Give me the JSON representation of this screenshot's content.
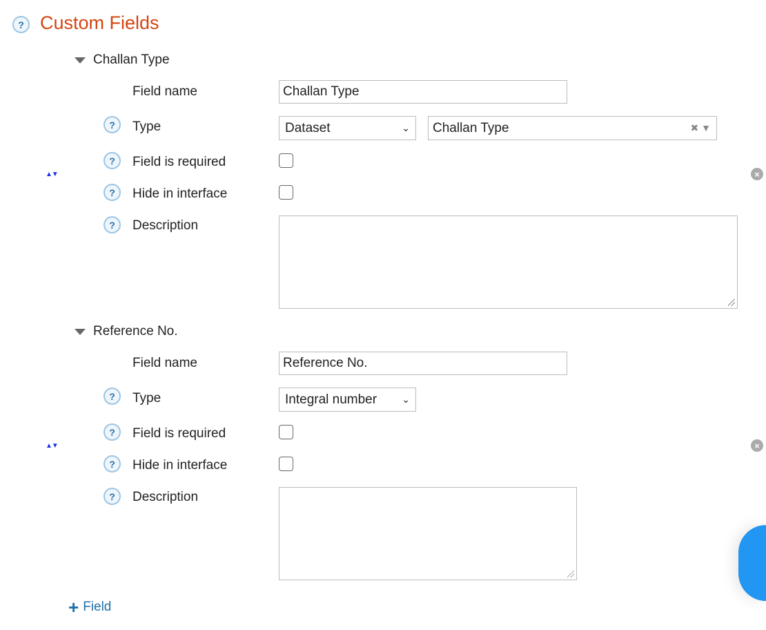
{
  "header": {
    "title": "Custom Fields",
    "help_icon": "question-circle-icon"
  },
  "labels": {
    "field_name": "Field name",
    "type": "Type",
    "required": "Field is required",
    "hide": "Hide in interface",
    "description": "Description"
  },
  "fields": [
    {
      "title": "Challan Type",
      "field_name": "Challan Type",
      "type": "Dataset",
      "dataset": "Challan Type",
      "required": false,
      "hide": false,
      "description": ""
    },
    {
      "title": "Reference No.",
      "field_name": "Reference No.",
      "type": "Integral number",
      "required": false,
      "hide": false,
      "description": ""
    }
  ],
  "add_field": {
    "icon": "+",
    "label": "Field"
  },
  "colors": {
    "title": "#d4450f",
    "link": "#1f6fa8",
    "fab": "#2196f3"
  }
}
